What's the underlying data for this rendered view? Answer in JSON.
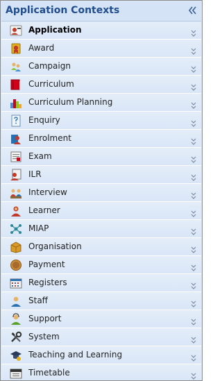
{
  "header": {
    "title": "Application Contexts",
    "collapse_icon": "double-chevron-left-icon"
  },
  "items": [
    {
      "label": "Application",
      "icon": "application-icon",
      "active": true
    },
    {
      "label": "Award",
      "icon": "award-icon"
    },
    {
      "label": "Campaign",
      "icon": "campaign-icon"
    },
    {
      "label": "Curriculum",
      "icon": "curriculum-icon"
    },
    {
      "label": "Curriculum Planning",
      "icon": "curriculum-planning-icon"
    },
    {
      "label": "Enquiry",
      "icon": "enquiry-icon"
    },
    {
      "label": "Enrolment",
      "icon": "enrolment-icon"
    },
    {
      "label": "Exam",
      "icon": "exam-icon"
    },
    {
      "label": "ILR",
      "icon": "ilr-icon"
    },
    {
      "label": "Interview",
      "icon": "interview-icon"
    },
    {
      "label": "Learner",
      "icon": "learner-icon"
    },
    {
      "label": "MIAP",
      "icon": "miap-icon"
    },
    {
      "label": "Organisation",
      "icon": "organisation-icon"
    },
    {
      "label": "Payment",
      "icon": "payment-icon"
    },
    {
      "label": "Registers",
      "icon": "registers-icon"
    },
    {
      "label": "Staff",
      "icon": "staff-icon"
    },
    {
      "label": "Support",
      "icon": "support-icon"
    },
    {
      "label": "System",
      "icon": "system-icon"
    },
    {
      "label": "Teaching and Learning",
      "icon": "teaching-and-learning-icon"
    },
    {
      "label": "Timetable",
      "icon": "timetable-icon"
    }
  ],
  "colors": {
    "header_text": "#1f4d8f",
    "row_bg": "#dce8f8",
    "chevron": "#7a8aa5"
  }
}
